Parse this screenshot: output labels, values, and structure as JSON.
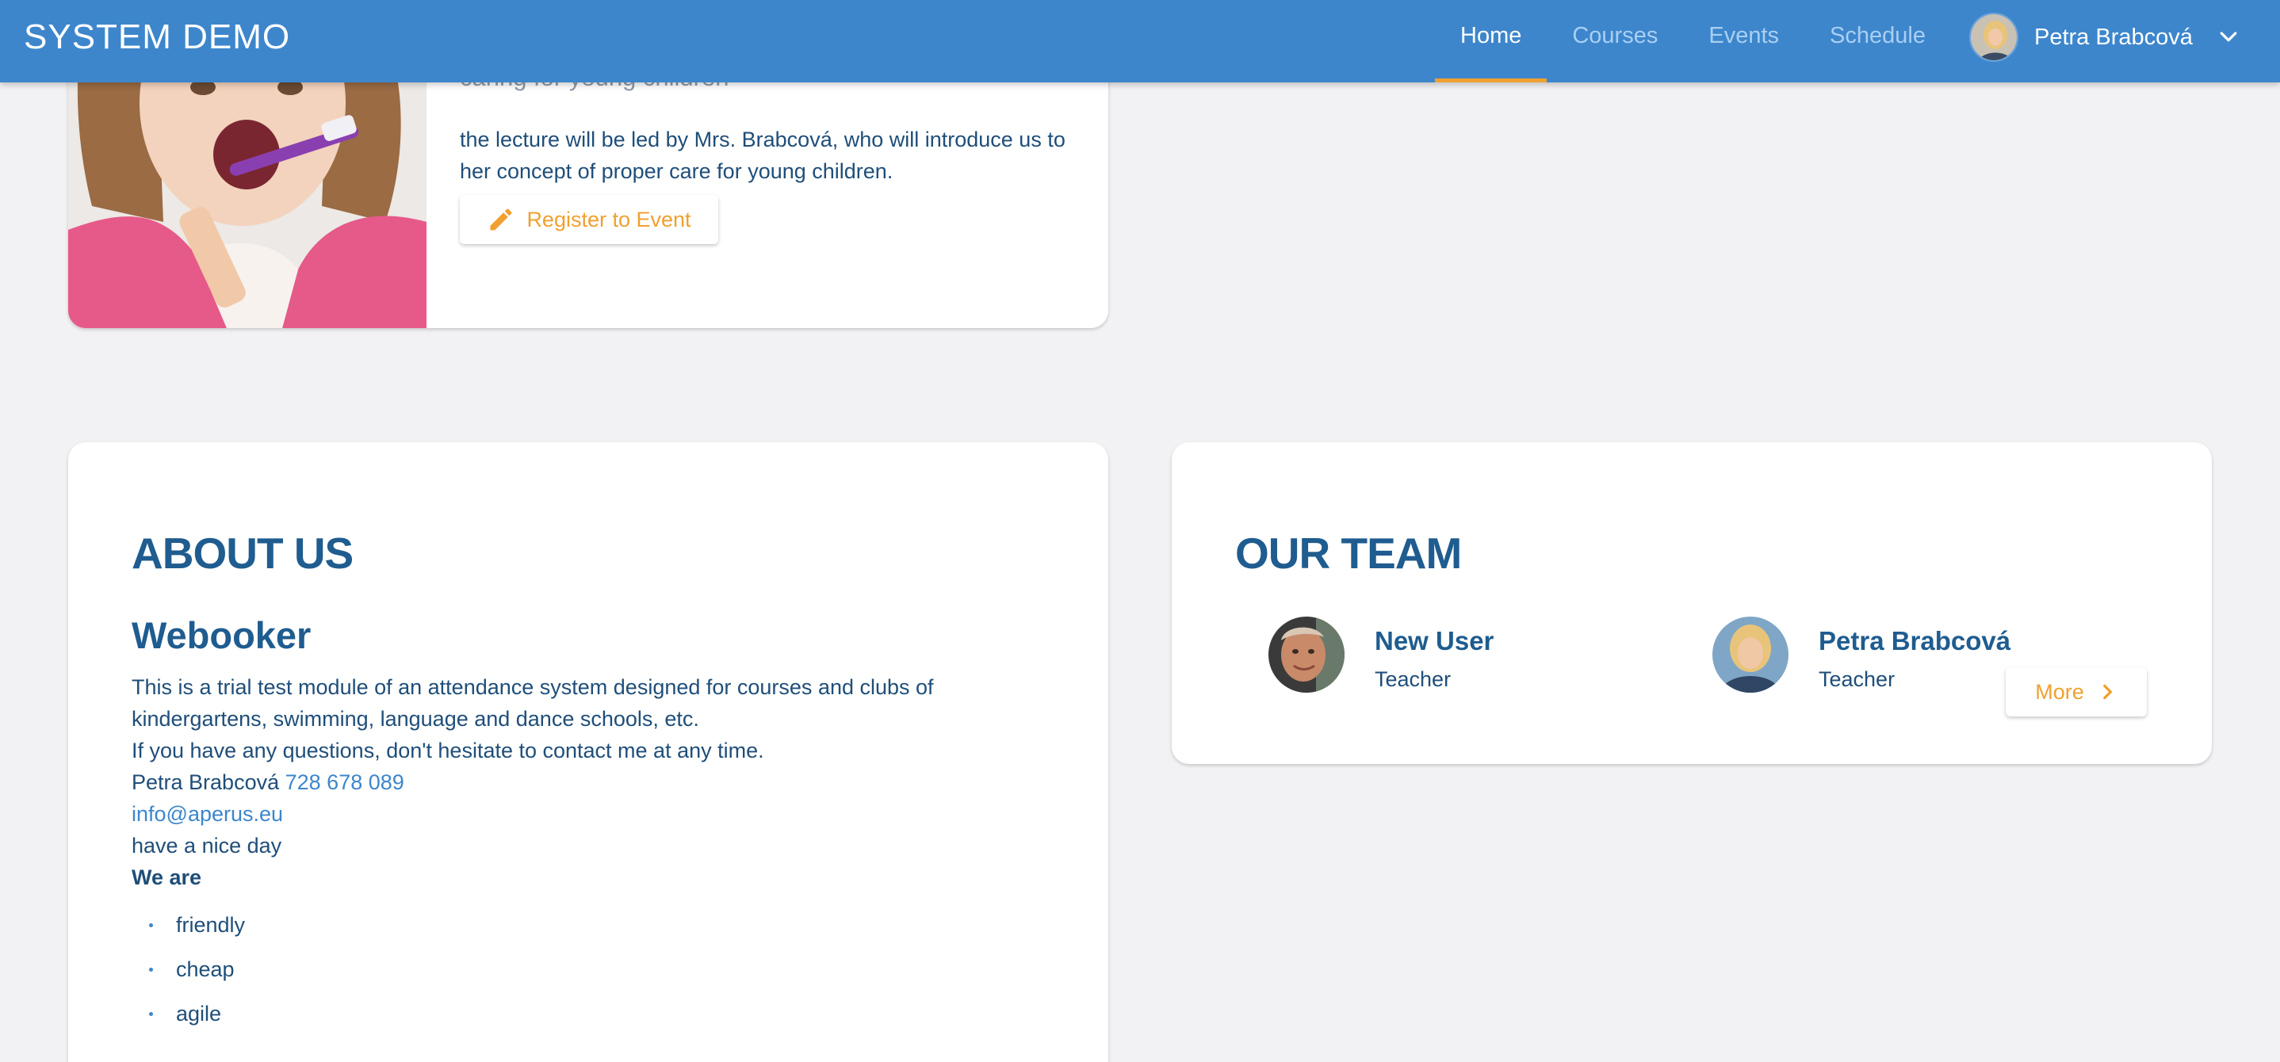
{
  "header": {
    "brand": "SYSTEM DEMO",
    "nav": [
      {
        "label": "Home",
        "active": true
      },
      {
        "label": "Courses",
        "active": false
      },
      {
        "label": "Events",
        "active": false
      },
      {
        "label": "Schedule",
        "active": false
      }
    ],
    "user_name": "Petra Brabcová",
    "accent_color": "#f0a030",
    "bar_color": "#3d86cc"
  },
  "event": {
    "subtitle": "caring for young children",
    "description": "the lecture will be led by Mrs. Brabcová, who will introduce us to her concept of proper care for young children.",
    "register_label": "Register to Event"
  },
  "about": {
    "title": "ABOUT US",
    "subtitle": "Webooker",
    "line1": "This is a trial test module of an attendance system designed for courses and clubs of kindergartens, swimming, language and dance schools, etc.",
    "line2": "If you have any questions, don't hesitate to contact me at any time.",
    "contact_name": "Petra Brabcová",
    "phone": "728 678 089",
    "email": "info@aperus.eu",
    "greeting": "have a nice day",
    "we_are": "We are",
    "traits": [
      "friendly",
      "cheap",
      "agile"
    ]
  },
  "team": {
    "title": "OUR TEAM",
    "members": [
      {
        "name": "New User",
        "role": "Teacher"
      },
      {
        "name": "Petra Brabcová",
        "role": "Teacher"
      }
    ],
    "more_label": "More"
  }
}
